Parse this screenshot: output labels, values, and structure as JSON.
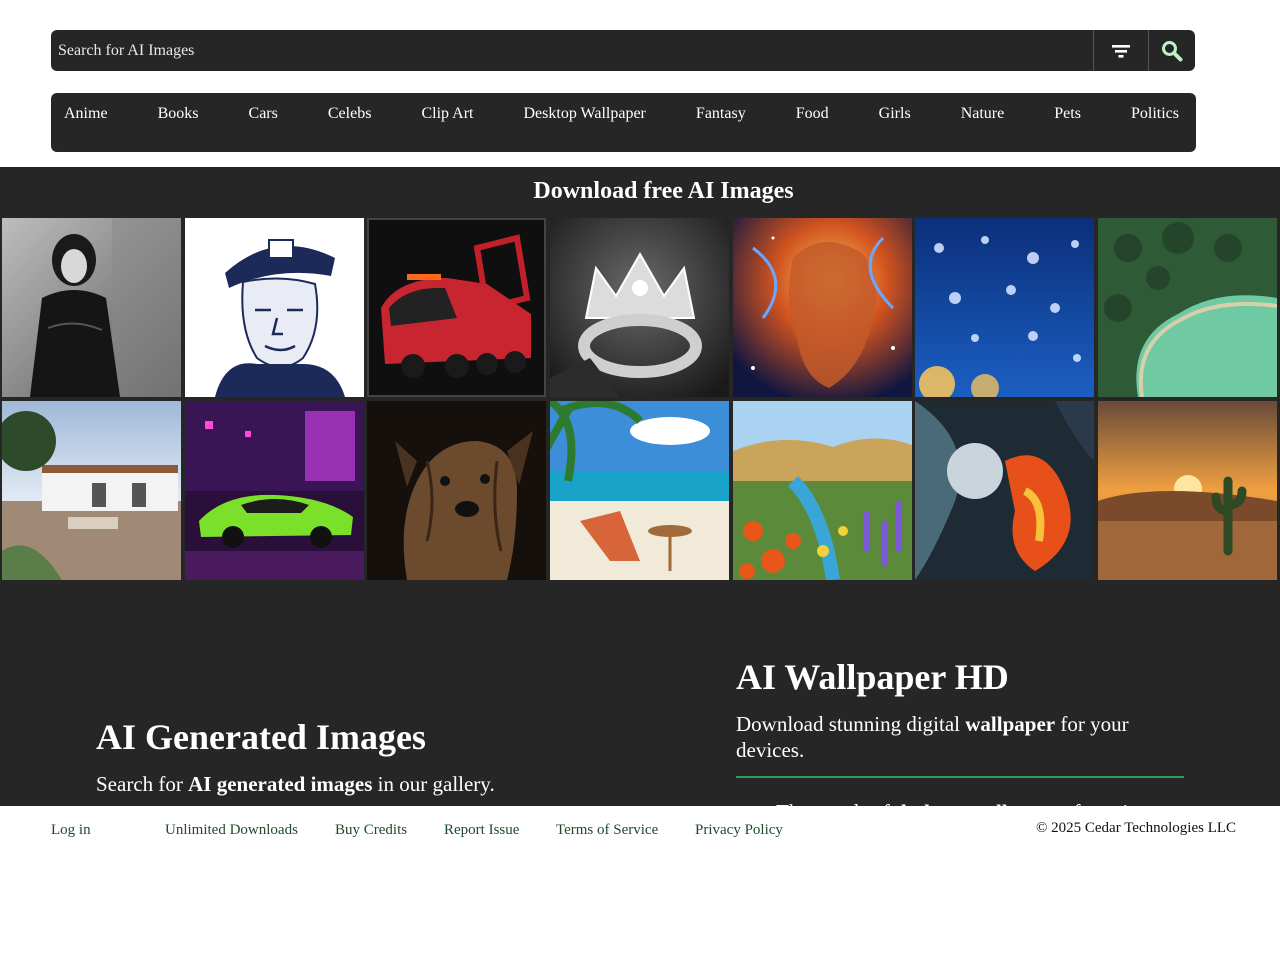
{
  "search": {
    "placeholder": "Search for AI Images",
    "filter_icon": "filter-icon",
    "search_icon": "magnifier-icon",
    "search_icon_color": "#b9f2c8"
  },
  "categories": [
    "Anime",
    "Books",
    "Cars",
    "Celebs",
    "Clip Art",
    "Desktop Wallpaper",
    "Fantasy",
    "Food",
    "Girls",
    "Nature",
    "Pets",
    "Politics"
  ],
  "gallery": {
    "title": "Download free AI Images",
    "images": [
      "woman-in-black-lace-bw",
      "washington-nypd-cap-engraving",
      "red-fire-truck-concept",
      "diamond-crown-ring",
      "cosmic-face-painting",
      "water-droplets-blue",
      "aerial-lake-forest",
      "patio-house-garden",
      "green-sports-car-neon",
      "brindle-dog-portrait",
      "beach-chair-palm-painting",
      "flower-field-river-painting",
      "abstract-fire-ice-painting",
      "desert-sunset-cactus"
    ]
  },
  "left": {
    "title": "AI Generated Images",
    "sub_pre": "Search for ",
    "sub_bold": "AI generated images",
    "sub_post": " in our gallery."
  },
  "right": {
    "title": "AI Wallpaper HD",
    "sub_pre": "Download stunning digital ",
    "sub_bold": "wallpaper",
    "sub_post": " for your devices.",
    "bullet_pre": "Thousands of ",
    "bullet_bold": "desktop wallpapers",
    "bullet_post": " featuring"
  },
  "footer": {
    "login": "Log in",
    "links": [
      "Unlimited Downloads",
      "Buy Credits",
      "Report Issue",
      "Terms of Service",
      "Privacy Policy"
    ],
    "copyright": "© 2025 Cedar Technologies LLC"
  },
  "colors": {
    "panel": "#262626",
    "accent_green": "#2e9e4f",
    "footer_link": "#1f4a2c"
  }
}
